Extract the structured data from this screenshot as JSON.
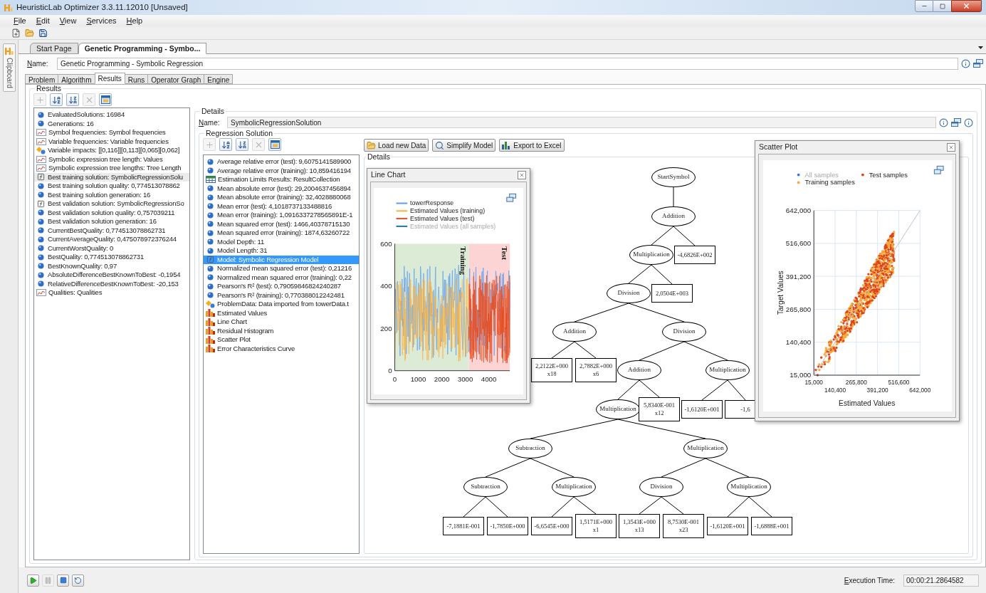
{
  "window": {
    "title": "HeuristicLab Optimizer 3.3.11.12010 [Unsaved]"
  },
  "menu": [
    {
      "label": "File"
    },
    {
      "label": "Edit"
    },
    {
      "label": "View"
    },
    {
      "label": "Services"
    },
    {
      "label": "Help"
    }
  ],
  "toolbar": [
    {
      "kind": "new"
    },
    {
      "kind": "open"
    },
    {
      "kind": "save"
    }
  ],
  "side_panel": {
    "tab": "Clipboard"
  },
  "document_tabs": [
    {
      "label": "Start Page",
      "selected": false
    },
    {
      "label": "Genetic Programming - Symbo...",
      "selected": true
    }
  ],
  "name_field": {
    "label": "Name:",
    "value": "Genetic Programming - Symbolic Regression"
  },
  "view_tabs": [
    {
      "label": "Problem",
      "selected": false
    },
    {
      "label": "Algorithm",
      "selected": false
    },
    {
      "label": "Results",
      "selected": true
    },
    {
      "label": "Runs",
      "selected": false
    },
    {
      "label": "Operator Graph",
      "selected": false
    },
    {
      "label": "Engine",
      "selected": false
    }
  ],
  "results": {
    "title": "Results",
    "toolbar": [
      {
        "kind": "add",
        "disabled": true
      },
      {
        "kind": "sort-asc",
        "disabled": false
      },
      {
        "kind": "sort-desc",
        "disabled": false
      },
      {
        "kind": "remove",
        "disabled": true
      },
      {
        "kind": "view",
        "disabled": false
      }
    ],
    "list": {
      "focused": false,
      "items": [
        {
          "kind": "value",
          "label": "EvaluatedSolutions: 16984",
          "selected": false
        },
        {
          "kind": "value",
          "label": "Generations: 16",
          "selected": false
        },
        {
          "kind": "chart",
          "label": "Symbol frequencies: Symbol frequencies",
          "selected": false
        },
        {
          "kind": "chart",
          "label": "Variable frequencies: Variable frequencies",
          "selected": false
        },
        {
          "kind": "impacts",
          "label": "Variable impacts: [[0,116]][0,113][0,065][0,062]",
          "selected": false
        },
        {
          "kind": "chart",
          "label": "Symbolic expression tree length: Values",
          "selected": false
        },
        {
          "kind": "chart",
          "label": "Symbolic expression tree lengths: Tree Length",
          "selected": false
        },
        {
          "kind": "function",
          "label": "Best training solution: SymbolicRegressionSolu",
          "selected": true
        },
        {
          "kind": "value",
          "label": "Best training solution quality: 0,774513078862",
          "selected": false
        },
        {
          "kind": "value",
          "label": "Best training solution generation: 16",
          "selected": false
        },
        {
          "kind": "function",
          "label": "Best validation solution: SymbolicRegressionSo",
          "selected": false
        },
        {
          "kind": "value",
          "label": "Best validation solution quality: 0,757039211",
          "selected": false
        },
        {
          "kind": "value",
          "label": "Best validation solution generation: 16",
          "selected": false
        },
        {
          "kind": "value",
          "label": "CurrentBestQuality: 0,774513078862731",
          "selected": false
        },
        {
          "kind": "value",
          "label": "CurrentAverageQuality: 0,475078972376244",
          "selected": false
        },
        {
          "kind": "value",
          "label": "CurrentWorstQuality: 0",
          "selected": false
        },
        {
          "kind": "value",
          "label": "BestQuality: 0,774513078862731",
          "selected": false
        },
        {
          "kind": "value",
          "label": "BestKnownQuality: 0,97",
          "selected": false
        },
        {
          "kind": "value",
          "label": "AbsoluteDifferenceBestKnownToBest: -0,1954",
          "selected": false
        },
        {
          "kind": "value",
          "label": "RelativeDifferenceBestKnownToBest: -20,153",
          "selected": false
        },
        {
          "kind": "chart",
          "label": "Qualities: Qualities",
          "selected": false
        }
      ]
    },
    "details": {
      "title": "Details",
      "name_field": {
        "label": "Name:",
        "value": "SymbolicRegressionSolution"
      },
      "solution": {
        "title": "Regression Solution",
        "toolbar": [
          {
            "kind": "add",
            "disabled": true
          },
          {
            "kind": "sort-asc",
            "disabled": false
          },
          {
            "kind": "sort-desc",
            "disabled": false
          },
          {
            "kind": "remove",
            "disabled": true
          },
          {
            "kind": "view",
            "disabled": false
          }
        ],
        "list": {
          "focused": true,
          "items": [
            {
              "kind": "value",
              "label": "Average relative error (test): 9,6075141589900",
              "selected": false
            },
            {
              "kind": "value",
              "label": "Average relative error (training): 10,859416194",
              "selected": false
            },
            {
              "kind": "collection",
              "label": "Estimation Limits Results: ResultCollection",
              "selected": false
            },
            {
              "kind": "value",
              "label": "Mean absolute error (test): 29,2004637456894",
              "selected": false
            },
            {
              "kind": "value",
              "label": "Mean absolute error (training): 32,4028880068",
              "selected": false
            },
            {
              "kind": "value",
              "label": "Mean error (test): 4,1018737133488816",
              "selected": false
            },
            {
              "kind": "value",
              "label": "Mean error (training): 1,0916337278565891E-1",
              "selected": false
            },
            {
              "kind": "value",
              "label": "Mean squared error (test): 1466,40378715130",
              "selected": false
            },
            {
              "kind": "value",
              "label": "Mean squared error (training): 1874,63260722",
              "selected": false
            },
            {
              "kind": "value",
              "label": "Model Depth: 11",
              "selected": false
            },
            {
              "kind": "value",
              "label": "Model Length: 31",
              "selected": false
            },
            {
              "kind": "function",
              "label": "Model: Symbolic Regression Model",
              "selected": true
            },
            {
              "kind": "value",
              "label": "Normalized mean squared error (test): 0,21216",
              "selected": false
            },
            {
              "kind": "value",
              "label": "Normalized mean squared error (training): 0,22",
              "selected": false
            },
            {
              "kind": "value",
              "label": "Pearson's R² (test): 0,79059846824240287",
              "selected": false
            },
            {
              "kind": "value",
              "label": "Pearson's R² (training): 0,770388012242481",
              "selected": false
            },
            {
              "kind": "impacts",
              "label": "ProblemData: Data imported from towerData.t",
              "selected": false
            },
            {
              "kind": "plot",
              "label": "Estimated Values",
              "selected": false
            },
            {
              "kind": "plot",
              "label": "Line Chart",
              "selected": false
            },
            {
              "kind": "plot",
              "label": "Residual Histogram",
              "selected": false
            },
            {
              "kind": "plot",
              "label": "Scatter Plot",
              "selected": false
            },
            {
              "kind": "plot",
              "label": "Error Characteristics Curve",
              "selected": false
            }
          ]
        },
        "buttons": [
          {
            "kind": "load",
            "label": "Load new Data"
          },
          {
            "kind": "simplify",
            "label": "Simplify Model"
          },
          {
            "kind": "export",
            "label": "Export to Excel"
          }
        ],
        "details": {
          "title": "Details",
          "tree": {
            "kind": "function",
            "label": "StartSymbol",
            "children": [
              {
                "kind": "function",
                "label": "Addition",
                "children": [
                  {
                    "kind": "function",
                    "label": "Multiplication",
                    "children": [
                      {
                        "kind": "function",
                        "label": "Division",
                        "children": [
                          {
                            "kind": "function",
                            "label": "Addition",
                            "children": [
                              {
                                "kind": "terminal",
                                "label": "2,2122E+000",
                                "variable": "x18"
                              },
                              {
                                "kind": "terminal",
                                "label": "2,7882E+000",
                                "variable": "x6"
                              }
                            ]
                          },
                          {
                            "kind": "function",
                            "label": "Division",
                            "children": [
                              {
                                "kind": "function",
                                "label": "Addition",
                                "children": [
                                  {
                                    "kind": "function",
                                    "label": "Multiplication",
                                    "children": [
                                      {
                                        "kind": "function",
                                        "label": "Subtraction",
                                        "children": [
                                          {
                                            "kind": "function",
                                            "label": "Subtraction",
                                            "children": [
                                              {
                                                "kind": "terminal",
                                                "label": "-7,1881E-001"
                                              },
                                              {
                                                "kind": "terminal",
                                                "label": "-1,7850E+000"
                                              }
                                            ]
                                          },
                                          {
                                            "kind": "function",
                                            "label": "Multiplication",
                                            "children": [
                                              {
                                                "kind": "terminal",
                                                "label": "-6,6545E+000"
                                              },
                                              {
                                                "kind": "terminal",
                                                "label": "1,5171E+000",
                                                "variable": "x1"
                                              }
                                            ]
                                          }
                                        ]
                                      },
                                      {
                                        "kind": "function",
                                        "label": "Multiplication",
                                        "children": [
                                          {
                                            "kind": "function",
                                            "label": "Division",
                                            "children": [
                                              {
                                                "kind": "terminal",
                                                "label": "1,3543E+000",
                                                "variable": "x13"
                                              },
                                              {
                                                "kind": "terminal",
                                                "label": "8,7530E-001",
                                                "variable": "x23"
                                              }
                                            ]
                                          },
                                          {
                                            "kind": "function",
                                            "label": "Multiplication",
                                            "children": [
                                              {
                                                "kind": "terminal",
                                                "label": "-1,6120E+001"
                                              },
                                              {
                                                "kind": "terminal",
                                                "label": "-1,6888E+001"
                                              }
                                            ]
                                          }
                                        ]
                                      }
                                    ]
                                  },
                                  {
                                    "kind": "terminal",
                                    "label": "5,8340E-001",
                                    "variable": "x12"
                                  }
                                ]
                              },
                              {
                                "kind": "function",
                                "label": "Multiplication",
                                "children": [
                                  {
                                    "kind": "terminal",
                                    "label": "-1,6120E+001"
                                  },
                                  {
                                    "kind": "terminal",
                                    "label": "-1,6"
                                  }
                                ]
                              }
                            ]
                          }
                        ]
                      },
                      {
                        "kind": "terminal",
                        "label": "2,0504E+003"
                      }
                    ]
                  },
                  {
                    "kind": "terminal",
                    "label": "-4,6826E+002"
                  }
                ]
              }
            ]
          },
          "line_chart": {
            "title": "Line Chart",
            "legend": [
              {
                "label": "towerResponse",
                "color": "#5b9bf0",
                "hidden": false
              },
              {
                "label": "Estimated Values (training)",
                "color": "#fbb03b",
                "hidden": false
              },
              {
                "label": "Estimated Values (test)",
                "color": "#e84c1c",
                "hidden": false
              },
              {
                "label": "Estimated Values (all samples)",
                "color": "#1f6fb0",
                "hidden": true
              }
            ],
            "yticks": [
              "600",
              "400",
              "200",
              "0"
            ],
            "xticks": [
              "0",
              "1000",
              "2000",
              "3000",
              "4000"
            ],
            "regions": [
              "Training",
              "Test"
            ]
          },
          "scatter_plot": {
            "title": "Scatter Plot",
            "legend": [
              {
                "label": "All samples",
                "color": "#3c78d8",
                "hidden": true
              },
              {
                "label": "Test samples",
                "color": "#e0441a",
                "hidden": false
              },
              {
                "label": "Training samples",
                "color": "#f9a93a",
                "hidden": false
              }
            ],
            "yticks": [
              "642,000",
              "516,600",
              "391,200",
              "265,800",
              "140,400",
              "15,000"
            ],
            "xticks": [
              "15,000",
              "140,400",
              "265,800",
              "391,200",
              "516,600",
              "642,000"
            ],
            "xlabel": "Estimated Values",
            "ylabel": "Target Values"
          }
        }
      }
    }
  },
  "run_controls": [
    {
      "kind": "start",
      "disabled": false
    },
    {
      "kind": "pause",
      "disabled": true
    },
    {
      "kind": "stop",
      "disabled": false
    },
    {
      "kind": "reset",
      "disabled": false
    }
  ],
  "execution_time": {
    "label": "Execution Time:",
    "value": "00:00:21.2864582"
  }
}
